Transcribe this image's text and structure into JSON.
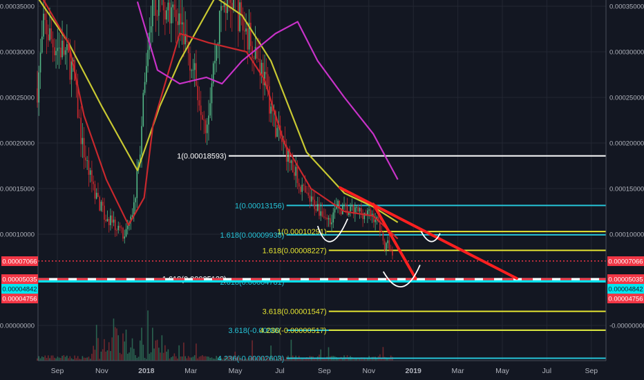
{
  "chart_data": {
    "type": "candlestick",
    "title": "",
    "x_unit": "months since Sep 2017",
    "x_ticks": [
      {
        "m": 0,
        "label": "Sep"
      },
      {
        "m": 2,
        "label": "Nov"
      },
      {
        "m": 4,
        "label": "2018"
      },
      {
        "m": 6,
        "label": "Mar"
      },
      {
        "m": 8,
        "label": "May"
      },
      {
        "m": 10,
        "label": "Jul"
      },
      {
        "m": 12,
        "label": "Sep"
      },
      {
        "m": 14,
        "label": "Nov"
      },
      {
        "m": 16,
        "label": "2019"
      },
      {
        "m": 18,
        "label": "Mar"
      },
      {
        "m": 20,
        "label": "May"
      },
      {
        "m": 22,
        "label": "Jul"
      },
      {
        "m": 24,
        "label": "Sep"
      }
    ],
    "y_ticks": [
      {
        "v": 0.00035,
        "label": "0.00035000"
      },
      {
        "v": 0.0003,
        "label": "0.00030000"
      },
      {
        "v": 0.00025,
        "label": "0.00025000"
      },
      {
        "v": 0.0002,
        "label": "0.00020000"
      },
      {
        "v": 0.00015,
        "label": "0.00015000"
      },
      {
        "v": 0.0001,
        "label": "0.00010000"
      },
      {
        "v": 0.0,
        "label": "-0.00000000"
      }
    ],
    "grid": true,
    "price_path": [
      [
        -0.9,
        0.00026
      ],
      [
        -0.6,
        0.00033
      ],
      [
        -0.2,
        0.00031
      ],
      [
        0.3,
        0.0003
      ],
      [
        0.7,
        0.00028
      ],
      [
        1.1,
        0.0002
      ],
      [
        1.5,
        0.00016
      ],
      [
        2.1,
        0.00012
      ],
      [
        2.6,
        0.00011
      ],
      [
        3.0,
        0.0001
      ],
      [
        3.4,
        0.00012
      ],
      [
        3.7,
        0.00019
      ],
      [
        4.1,
        0.00033
      ],
      [
        4.5,
        0.00036
      ],
      [
        4.9,
        0.00035
      ],
      [
        5.4,
        0.00034
      ],
      [
        5.8,
        0.00031
      ],
      [
        6.2,
        0.00027
      ],
      [
        6.7,
        0.00022
      ],
      [
        7.1,
        0.0003
      ],
      [
        7.4,
        0.00035
      ],
      [
        7.9,
        0.00036
      ],
      [
        8.3,
        0.00033
      ],
      [
        8.8,
        0.00031
      ],
      [
        9.2,
        0.00028
      ],
      [
        9.6,
        0.00024
      ],
      [
        9.9,
        0.00021
      ],
      [
        10.3,
        0.00019
      ],
      [
        10.8,
        0.00016
      ],
      [
        11.2,
        0.00014
      ],
      [
        11.7,
        0.00013
      ],
      [
        12.2,
        0.000115
      ],
      [
        12.6,
        0.00013
      ],
      [
        13.0,
        0.000125
      ],
      [
        13.6,
        0.000125
      ],
      [
        14.2,
        0.00012
      ],
      [
        14.5,
        0.00011
      ],
      [
        14.7,
        8.5e-05
      ],
      [
        14.9,
        9e-05
      ],
      [
        15.1,
        7e-05
      ]
    ],
    "series": [
      {
        "name": "MA yellow",
        "color": "#c8c832",
        "points": [
          [
            -0.9,
            0.00036
          ],
          [
            0.5,
            0.00031
          ],
          [
            2.0,
            0.00024
          ],
          [
            3.6,
            0.00017
          ],
          [
            4.6,
            0.00024
          ],
          [
            5.5,
            0.00029
          ],
          [
            7.1,
            0.00036
          ],
          [
            8.3,
            0.00034
          ],
          [
            9.6,
            0.00029
          ],
          [
            11.2,
            0.00019
          ],
          [
            12.9,
            0.000145
          ],
          [
            14.2,
            0.00013
          ],
          [
            15.3,
            0.000113
          ]
        ]
      },
      {
        "name": "MA red",
        "color": "#c8282d",
        "points": [
          [
            -0.7,
            0.00036
          ],
          [
            0.5,
            0.00031
          ],
          [
            1.2,
            0.00023
          ],
          [
            2.2,
            0.00016
          ],
          [
            3.2,
            0.00011
          ],
          [
            3.9,
            0.00014
          ],
          [
            4.3,
            0.00022
          ],
          [
            5.5,
            0.00032
          ],
          [
            6.8,
            0.00031
          ],
          [
            8.5,
            0.0003
          ],
          [
            9.3,
            0.00027
          ],
          [
            10.2,
            0.0002
          ],
          [
            11.4,
            0.00015
          ],
          [
            12.9,
            0.000125
          ],
          [
            14.2,
            0.00012
          ],
          [
            15.3,
            9.5e-05
          ]
        ]
      },
      {
        "name": "MA magenta",
        "color": "#c832c8",
        "points": [
          [
            3.6,
            0.000355
          ],
          [
            4.5,
            0.00028
          ],
          [
            5.5,
            0.000265
          ],
          [
            6.7,
            0.000272
          ],
          [
            7.4,
            0.000265
          ],
          [
            8.3,
            0.00029
          ],
          [
            9.8,
            0.00032
          ],
          [
            10.8,
            0.000333
          ],
          [
            11.7,
            0.00029
          ],
          [
            12.9,
            0.00025
          ],
          [
            14.2,
            0.00021
          ],
          [
            15.3,
            0.00016
          ]
        ]
      }
    ],
    "fib_levels": [
      {
        "label": "1(0.00018593)",
        "value": 0.00018593,
        "color": "#ffffff",
        "from": 7.7,
        "label_end": 7.6
      },
      {
        "label": "1(0.00013156)",
        "value": 0.00013156,
        "color": "#26c6da",
        "from": 10.3,
        "label_end": 10.2
      },
      {
        "label": "1(0.00010291)",
        "value": 0.00010291,
        "color": "#e6e632",
        "from": 12.1,
        "label_end": 12.1
      },
      {
        "label": "1.618(0.00009938)",
        "value": 9.938e-05,
        "color": "#26c6da",
        "from": 10.3,
        "label_end": 10.2
      },
      {
        "label": "1.618(0.00008227)",
        "value": 8.227e-05,
        "color": "#e6e632",
        "from": 12.2,
        "label_end": 12.1
      },
      {
        "label": "1.618(0.00005128)",
        "value": 5.12e-05,
        "color": "#ffffff",
        "from": -0.9,
        "label_end": 7.6
      },
      {
        "label": "2.618(0.00004781)",
        "value": 4.78e-05,
        "color": "#26c6da",
        "from": -0.9,
        "label_end": 10.2
      },
      {
        "label": "3.618(0.00001547)",
        "value": 1.547e-05,
        "color": "#e6e632",
        "from": 12.2,
        "label_end": 12.1
      },
      {
        "label": "3.618(-0.00000",
        "value": -5.3e-06,
        "color": "#26c6da",
        "from": 10.3,
        "label_end": 10.0
      },
      {
        "label": "4.236(-0.00000517)",
        "value": -5.17e-06,
        "color": "#e6e632",
        "from": 12.2,
        "label_end": 12.1
      },
      {
        "label": "4.236(-0.00002603)",
        "value": -3.603e-05,
        "color": "#26c6da",
        "from": 10.3,
        "label_end": 10.2
      }
    ],
    "trendlines": [
      {
        "color": "#ff2020",
        "from": [
          12.7,
          0.000151
        ],
        "to": [
          20.65,
          5.15e-05
        ]
      },
      {
        "color": "#ff2020",
        "from": [
          14.2,
          0.000133
        ],
        "to": [
          16.1,
          5.15e-05
        ]
      }
    ],
    "arcs": [
      {
        "from": [
          11.7,
          0.000109
        ],
        "bottom": [
          12.3,
          9.2e-05
        ],
        "to": [
          13.05,
          0.000117
        ]
      },
      {
        "from": [
          16.35,
          0.000103
        ],
        "bottom": [
          16.8,
          9.2e-05
        ],
        "to": [
          17.2,
          0.000101
        ]
      },
      {
        "from": [
          14.65,
          5.9e-05
        ],
        "bottom": [
          15.5,
          4.25e-05
        ],
        "to": [
          16.3,
          6.63e-05
        ]
      }
    ],
    "price_badges": [
      {
        "label": "0.00007066",
        "value": 7.066e-05,
        "bg": "#f23645",
        "fg": "#ffffff",
        "line": "dotted"
      },
      {
        "label": "0.00005035",
        "value": 5.035e-05,
        "bg": "#f23645",
        "fg": "#ffffff",
        "line": "dashed"
      },
      {
        "label": "0.00004842",
        "value": 4.842e-05,
        "bg": "#00e5ef",
        "fg": "#131722",
        "line": "solid"
      },
      {
        "label": "0.00004756",
        "value": 4.756e-05,
        "bg": "#f23645",
        "fg": "#ffffff",
        "line": "none"
      }
    ]
  },
  "colors": {
    "background": "#131722",
    "grid": "#232733",
    "axis_text": "#b2b5be",
    "up": "#53b987",
    "down": "#c8282d"
  }
}
